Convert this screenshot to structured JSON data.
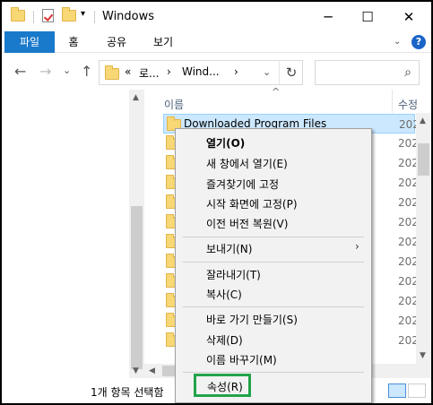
{
  "titlebar": {
    "title": "Windows",
    "buttons": {
      "minimize": "─",
      "maximize": "☐",
      "close": "✕"
    }
  },
  "ribbon": {
    "tabs": [
      "파일",
      "홈",
      "공유",
      "보기"
    ],
    "help": "?"
  },
  "address": {
    "back": "←",
    "forward": "→",
    "dropdown": "⌄",
    "up": "↑",
    "crumbs": [
      "«",
      "로...",
      "›",
      "Wind...",
      "›"
    ],
    "path_dropdown": "⌄",
    "refresh": "↻",
    "search_placeholder": "",
    "search_icon": "⌕"
  },
  "columns": {
    "name": "이름",
    "date": "수정"
  },
  "files": [
    {
      "name": "Downloaded Program Files",
      "date": "202",
      "selected": true
    },
    {
      "name": "",
      "date": "202"
    },
    {
      "name": "",
      "date": "202"
    },
    {
      "name": "",
      "date": "202"
    },
    {
      "name": "",
      "date": "202"
    },
    {
      "name": "",
      "date": "202"
    },
    {
      "name": "",
      "date": "202"
    },
    {
      "name": "",
      "date": "202"
    },
    {
      "name": "",
      "date": "202"
    },
    {
      "name": "",
      "date": "202"
    },
    {
      "name": "",
      "date": "202"
    },
    {
      "name": "",
      "date": "202"
    }
  ],
  "status": {
    "text": "1개 항목 선택함"
  },
  "context_menu": {
    "groups": [
      [
        "열기(O)",
        "새 창에서 열기(E)",
        "즐겨찾기에 고정",
        "시작 화면에 고정(P)",
        "이전 버전 복원(V)"
      ],
      [
        "보내기(N)"
      ],
      [
        "잘라내기(T)",
        "복사(C)"
      ],
      [
        "바로 가기 만들기(S)",
        "삭제(D)",
        "이름 바꾸기(M)"
      ],
      [
        "속성(R)"
      ]
    ],
    "submenu_arrow": "›"
  },
  "colors": {
    "file_tab": "#1979ca",
    "selection": "#cce8ff",
    "highlight_box": "#22a34a",
    "folder": "#f8d775"
  }
}
